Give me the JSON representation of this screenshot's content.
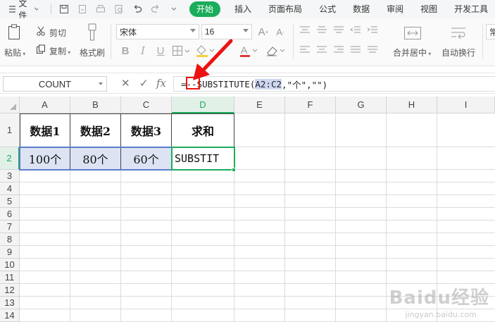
{
  "menubar": {
    "file_label": "文件",
    "tabs": [
      "开始",
      "插入",
      "页面布局",
      "公式",
      "数据",
      "审阅",
      "视图",
      "开发工具"
    ],
    "active_tab": "开始"
  },
  "ribbon": {
    "paste": "粘贴",
    "cut": "剪切",
    "copy": "复制",
    "format_painter": "格式刷",
    "font_name": "宋体",
    "font_size": "16",
    "merge_center": "合并居中",
    "wrap_text": "自动换行",
    "style_partial": "常"
  },
  "formula_bar": {
    "name_box": "COUNT",
    "formula_prefix": "=",
    "formula_dashes": "--",
    "formula_fn": "SUBSTITUTE(",
    "formula_range": "A2:C2",
    "formula_rest": ",\"个\",\"\")"
  },
  "grid": {
    "columns": [
      "A",
      "B",
      "C",
      "D",
      "E",
      "F",
      "G",
      "H",
      "I"
    ],
    "rows": [
      "1",
      "2",
      "3",
      "4",
      "5",
      "6",
      "7",
      "8",
      "9",
      "10",
      "11",
      "12",
      "13",
      "14"
    ],
    "headers": [
      "数据1",
      "数据2",
      "数据3",
      "求和"
    ],
    "values": [
      "100个",
      "80个",
      "60个"
    ],
    "editing_cell": "SUBSTIT"
  },
  "watermark": {
    "brand": "Baidu经验",
    "url": "jingyan.baidu.com"
  },
  "colors": {
    "accent": "#1aad5b",
    "range_fill": "#dde3f3",
    "range_border": "#5b7ccb",
    "annotation": "#e11111"
  }
}
